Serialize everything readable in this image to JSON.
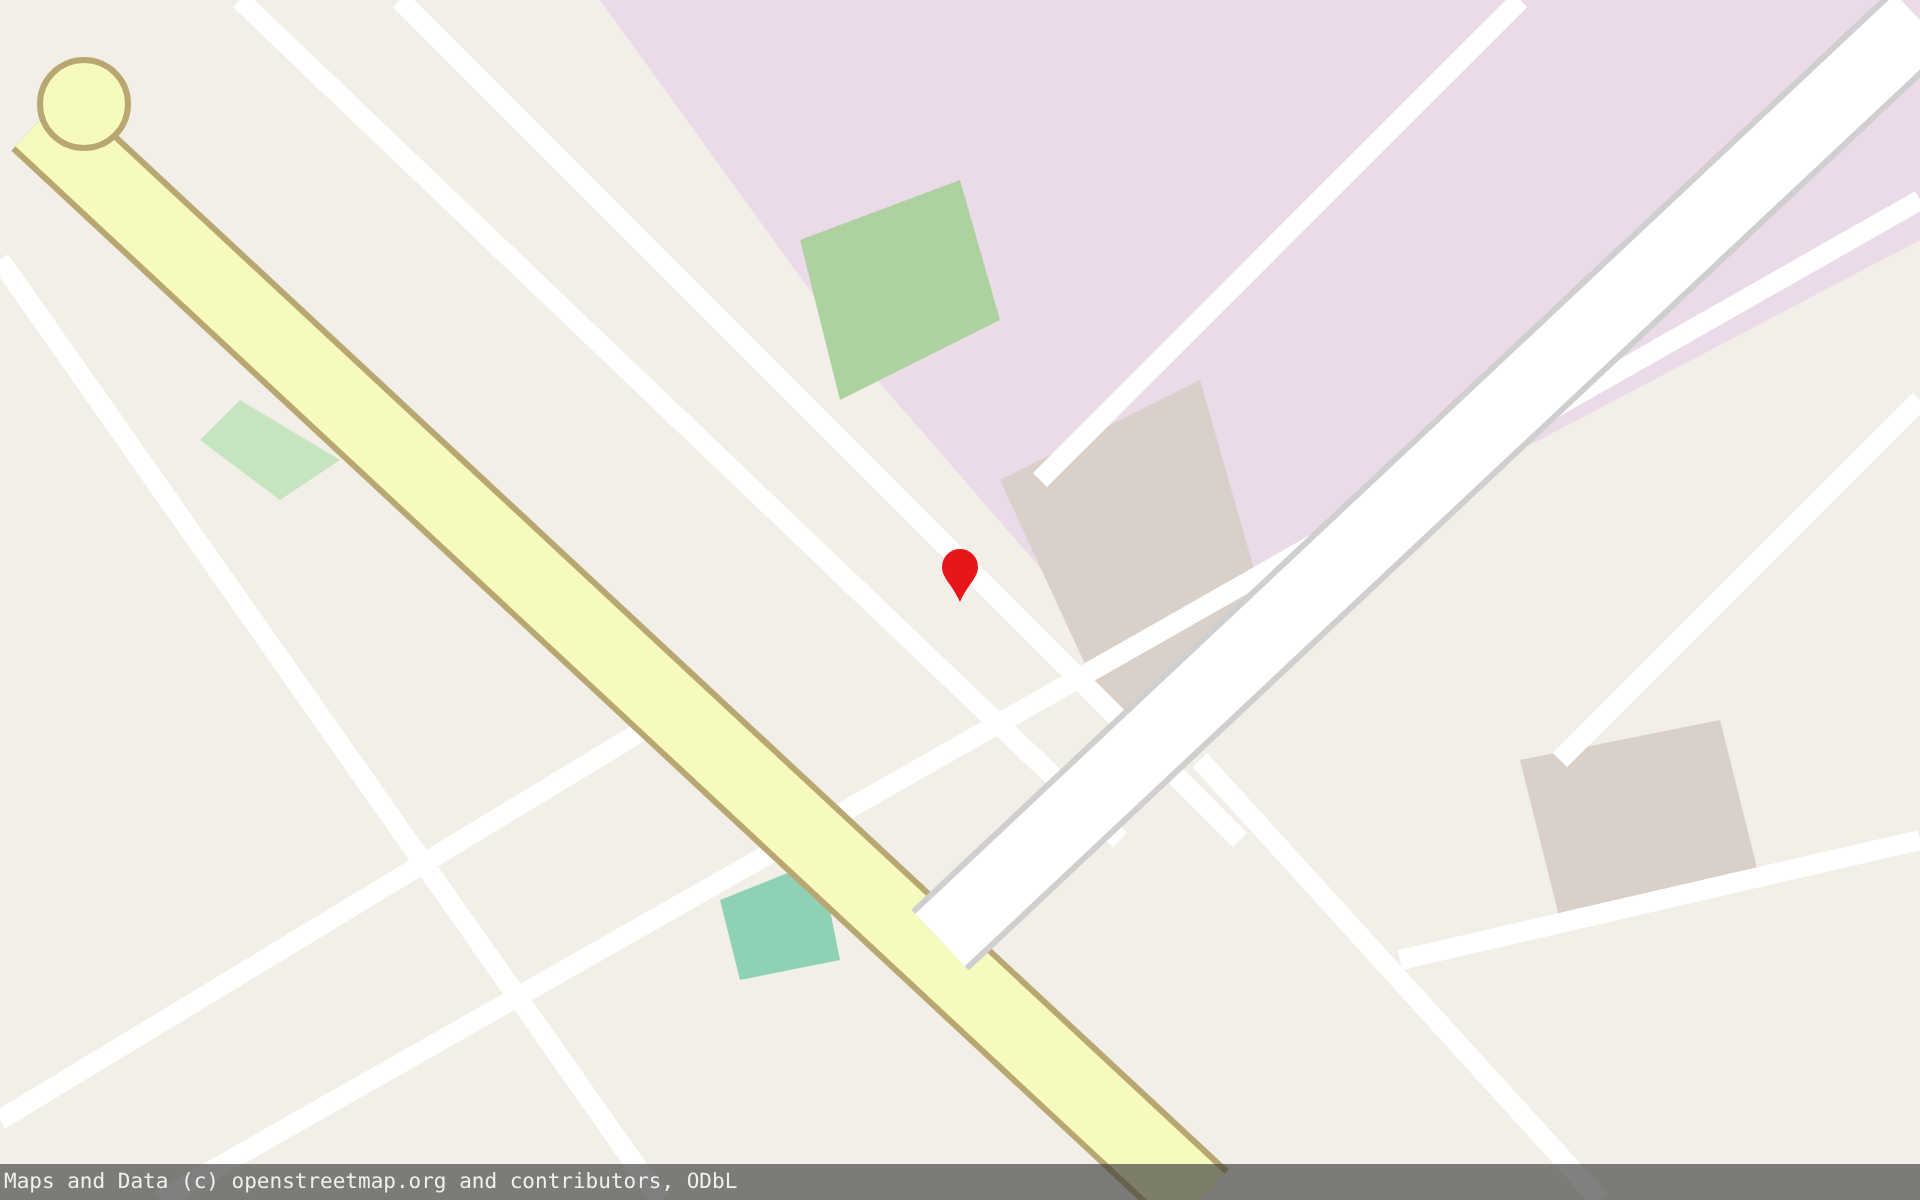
{
  "map": {
    "attribution": "Maps and Data (c) openstreetmap.org and contributors, ODbL"
  }
}
